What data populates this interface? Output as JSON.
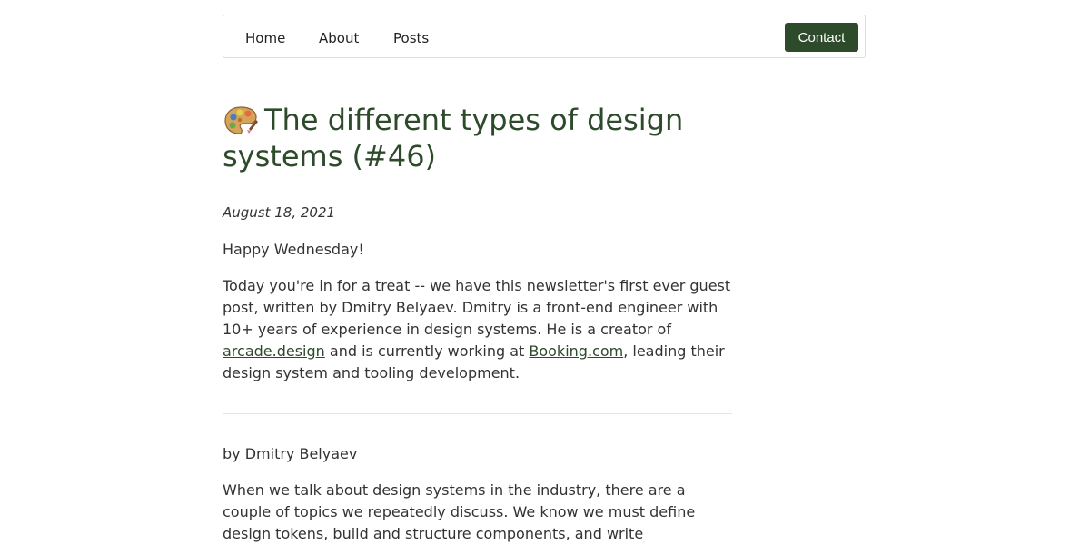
{
  "nav": {
    "home": "Home",
    "about": "About",
    "posts": "Posts",
    "contact": "Contact"
  },
  "article": {
    "emoji_icon": "artist-palette-icon",
    "title": "The different types of design systems (#46)",
    "date": "August 18, 2021",
    "greeting": "Happy Wednesday!",
    "intro": {
      "part1": "Today you're in for a treat -- we have this newsletter's first ever guest post, written by Dmitry Belyaev. Dmitry is a front-end engineer with 10+ years of experience in design systems. He is a creator of ",
      "link1": "arcade.design",
      "part2": " and is currently working at ",
      "link2": "Booking.com",
      "part3": ", leading their design system and tooling development."
    },
    "byline": "by Dmitry Belyaev",
    "body": "When we talk about design systems in the industry, there are a couple of topics we repeatedly discuss. We know we must define design tokens, build and structure components, and write documentation. We want our"
  }
}
